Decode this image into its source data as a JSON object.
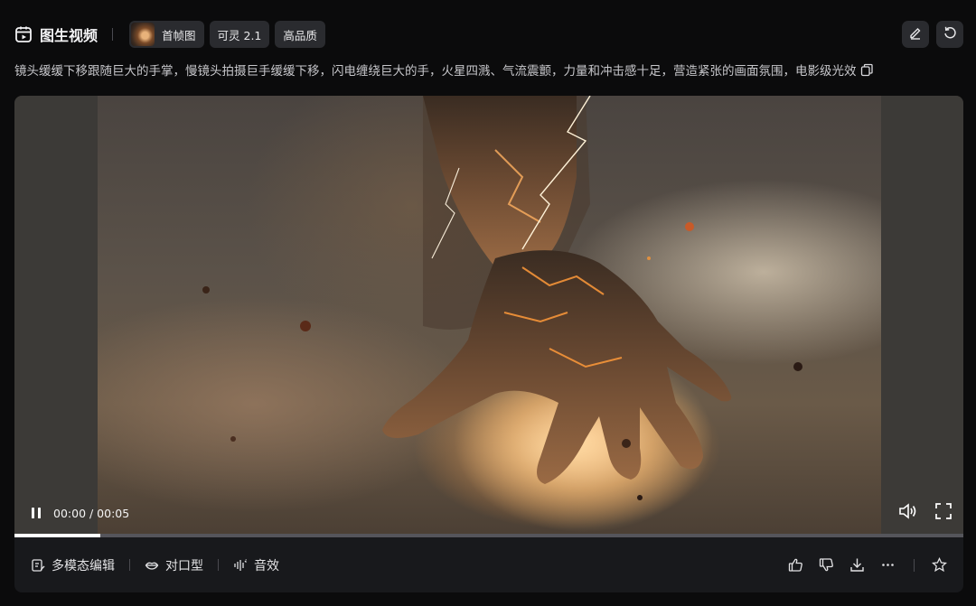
{
  "header": {
    "title": "图生视频",
    "chips": [
      {
        "label": "首帧图"
      },
      {
        "label": "可灵 2.1"
      },
      {
        "label": "高品质"
      }
    ]
  },
  "prompt": {
    "text": "镜头缓缓下移跟随巨大的手掌，慢镜头拍摄巨手缓缓下移，闪电缠绕巨大的手，火星四溅、气流震颤，力量和冲击感十足，营造紧张的画面氛围，电影级光效"
  },
  "player": {
    "time": "00:00 / 00:05",
    "progress": 0.09
  },
  "toolbar": {
    "multimodal_edit": "多模态编辑",
    "lip_sync": "对口型",
    "sound_effect": "音效"
  },
  "colors": {
    "background": "#0b0b0c",
    "card": "#18191c",
    "chip": "#2a2b2f",
    "accent_glow": "#f0a048"
  }
}
